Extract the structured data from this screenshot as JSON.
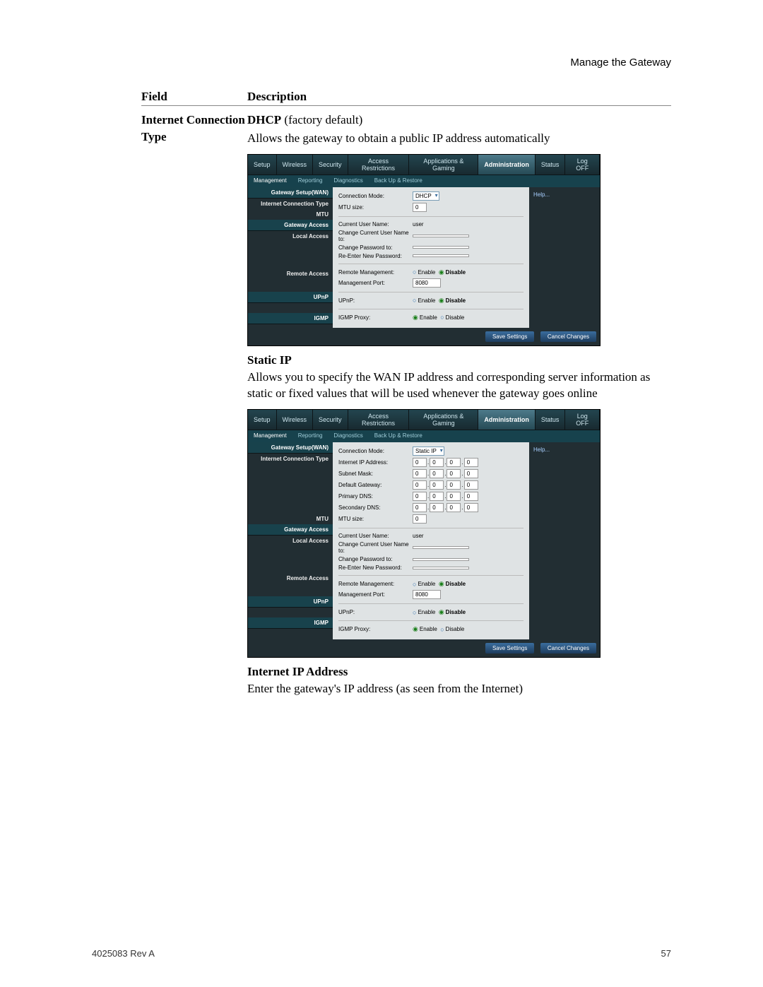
{
  "page": {
    "header": "Manage the Gateway",
    "footer_left": "4025083 Rev A",
    "footer_right": "57"
  },
  "columns": {
    "field": "Field",
    "description": "Description"
  },
  "row": {
    "field_label": "Internet Connection Type",
    "dhcp_bold": "DHCP",
    "dhcp_rest": " (factory default)",
    "dhcp_desc": "Allows the gateway to obtain a public IP address automatically",
    "static_title": "Static IP",
    "static_desc": "Allows you to specify the WAN IP address and corresponding server information as static or fixed values that will be used whenever the gateway goes online",
    "iip_title": "Internet IP Address",
    "iip_desc": "Enter the gateway's IP address (as seen from the Internet)"
  },
  "router_common": {
    "tabs": [
      "Setup",
      "Wireless",
      "Security",
      "Access\nRestrictions",
      "Applications\n& Gaming",
      "Administration",
      "Status",
      "Log OFF"
    ],
    "active_tab_index": 5,
    "subtabs": [
      "Management",
      "Reporting",
      "Diagnostics",
      "Back Up & Restore"
    ],
    "active_subtab_index": 0,
    "help": "Help...",
    "side": {
      "gateway_setup": "Gateway Setup(WAN)",
      "internet_conn_type": "Internet Connection Type",
      "mtu": "MTU",
      "gateway_access": "Gateway Access",
      "local_access": "Local Access",
      "remote_access": "Remote Access",
      "upnp": "UPnP",
      "igmp": "IGMP"
    },
    "labels": {
      "connection_mode": "Connection Mode:",
      "mtu_size": "MTU size:",
      "internet_ip": "Internet IP Address:",
      "subnet_mask": "Subnet Mask:",
      "default_gateway": "Default Gateway:",
      "primary_dns": "Primary DNS:",
      "secondary_dns": "Secondary DNS:",
      "current_user": "Current User Name:",
      "change_user": "Change Current User Name to:",
      "change_pw": "Change Password to:",
      "reenter_pw": "Re-Enter New Password:",
      "remote_mgmt": "Remote Management:",
      "mgmt_port": "Management Port:",
      "upnp": "UPnP:",
      "igmp_proxy": "IGMP Proxy:",
      "enable": "Enable",
      "disable": "Disable"
    },
    "values": {
      "mtu_size": "0",
      "current_user": "user",
      "mgmt_port": "8080",
      "ip_zero": "0"
    },
    "mode": {
      "dhcp": "DHCP",
      "static": "Static IP"
    },
    "buttons": {
      "save": "Save Settings",
      "cancel": "Cancel Changes"
    }
  }
}
